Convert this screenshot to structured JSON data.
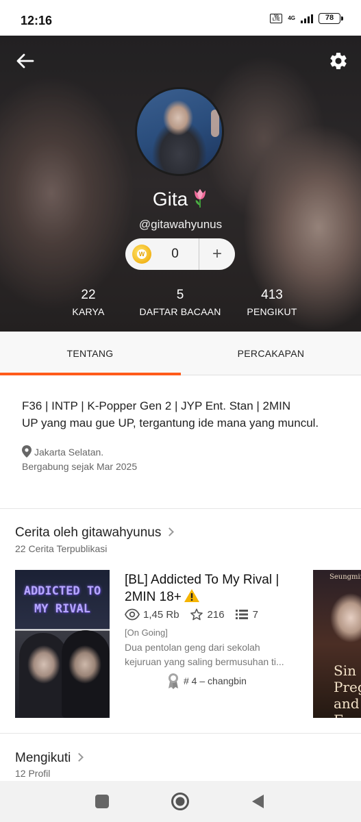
{
  "status_bar": {
    "time": "12:16",
    "volte": "Vo LTE",
    "network": "4G",
    "battery": "78"
  },
  "header": {
    "back_icon": "back-arrow-icon",
    "settings_icon": "gear-icon",
    "name": "Gita",
    "name_emoji": "tulip",
    "username": "@gitawahyunus",
    "coins": "0",
    "coin_add": "+",
    "stats": [
      {
        "value": "22",
        "label": "KARYA"
      },
      {
        "value": "5",
        "label": "DAFTAR BACAAN"
      },
      {
        "value": "413",
        "label": "PENGIKUT"
      }
    ]
  },
  "tabs": {
    "items": [
      {
        "label": "TENTANG",
        "active": true
      },
      {
        "label": "PERCAKAPAN",
        "active": false
      }
    ],
    "accent_color": "#ff5b1a"
  },
  "about": {
    "bio_line1": "F36 | INTP | K-Popper Gen 2 | JYP Ent. Stan | 2MIN",
    "bio_line2": "UP yang mau gue UP, tergantung ide mana yang muncul.",
    "location": "Jakarta Selatan.",
    "joined": "Bergabung sejak Mar 2025"
  },
  "stories": {
    "title": "Cerita oleh gitawahyunus",
    "subtitle": "22 Cerita Terpublikasi",
    "items": [
      {
        "cover_title": "ADDICTED TO MY RIVAL",
        "title": "[BL] Addicted To My Rival | 2MIN 18+",
        "reads": "1,45 Rb",
        "votes": "216",
        "parts": "7",
        "tag": "[On Going]",
        "description": "Dua pentolan geng dari sekolah kejuruan yang saling bermusuhan ti...",
        "rank": "# 4 – changbin"
      }
    ],
    "next_cover": {
      "top": "Seungmin",
      "text": "Sin\nPreg\nand F"
    }
  },
  "following": {
    "title": "Mengikuti",
    "subtitle": "12 Profil"
  },
  "navbar": {
    "buttons": [
      "recent-apps",
      "home",
      "back"
    ]
  }
}
